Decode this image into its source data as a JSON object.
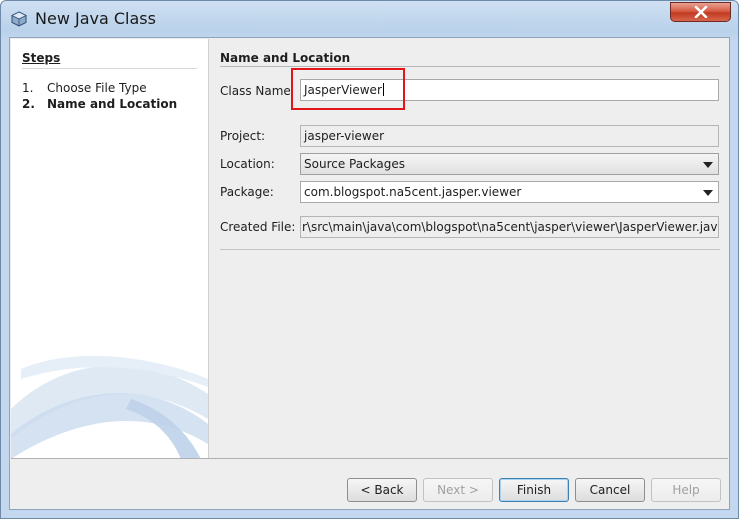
{
  "window": {
    "title": "New Java Class"
  },
  "steps": {
    "heading": "Steps",
    "items": [
      {
        "num": "1.",
        "label": "Choose File Type"
      },
      {
        "num": "2.",
        "label": "Name and Location"
      }
    ]
  },
  "form": {
    "heading": "Name and Location",
    "class_name_label": "Class Name",
    "class_name_value": "JasperViewer",
    "project_label": "Project:",
    "project_value": "jasper-viewer",
    "location_label": "Location:",
    "location_value": "Source Packages",
    "package_label": "Package:",
    "package_value": "com.blogspot.na5cent.jasper.viewer",
    "created_file_label": "Created File:",
    "created_file_value": "r\\src\\main\\java\\com\\blogspot\\na5cent\\jasper\\viewer\\JasperViewer.java"
  },
  "buttons": {
    "back": "< Back",
    "next": "Next >",
    "finish": "Finish",
    "cancel": "Cancel",
    "help": "Help"
  },
  "colors": {
    "highlight": "#e0161b",
    "close_button": "#c13b22"
  }
}
